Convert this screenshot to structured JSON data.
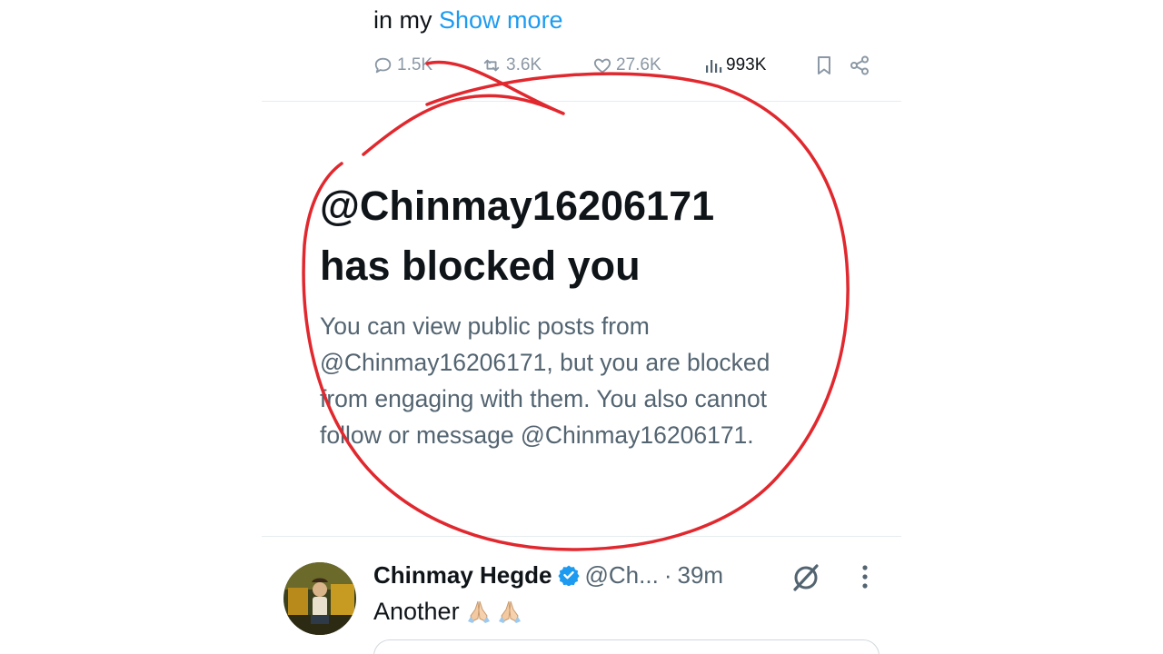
{
  "tweet": {
    "text_tail": "in my ",
    "show_more": "Show more",
    "stats": {
      "replies": "1.5K",
      "reposts": "3.6K",
      "likes": "27.6K",
      "views": "993K"
    }
  },
  "blocked_notice": {
    "title_line1": "@Chinmay16206171",
    "title_line2": "has blocked you",
    "body_line1": "You can view public posts from",
    "body_line2": "@Chinmay16206171, but you are blocked",
    "body_line3": "from engaging with them. You also cannot",
    "body_line4": "follow or message @Chinmay16206171."
  },
  "reply": {
    "author_name": "Chinmay Hegde",
    "handle": "@Ch...",
    "separator": "·",
    "time": "39m",
    "text": "Another"
  },
  "colors": {
    "link": "#1d9bf0",
    "annotation": "#e0282e",
    "verified": "#1d9bf0",
    "muted": "#536471"
  }
}
